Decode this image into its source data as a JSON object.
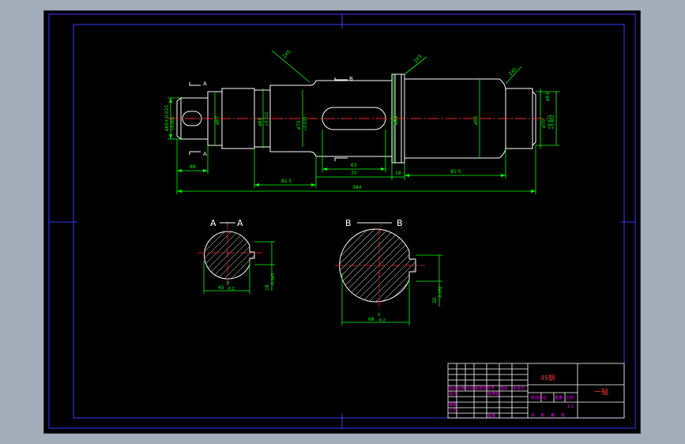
{
  "colors": {
    "background": "#a3adb9",
    "canvas": "#000000",
    "frame": "#3a3aff",
    "geometry": "#ffffff",
    "dimension": "#00ff00",
    "centerline": "#ff2020",
    "title_text": "#ff00ff",
    "title_grid": "#ffffff",
    "material_text": "#ff3030"
  },
  "main_view": {
    "section_a_label": "A",
    "section_b_label": "B",
    "dims": {
      "d_end": "ø60+0.021",
      "d_end_lower": "+0.002",
      "d_67": "ø67",
      "d_80": "ø80",
      "d_80_tol": "+0.021",
      "d_75": "ø75",
      "d_75_tol": "+0.030",
      "d_75_tol2": "+0.002",
      "d_84": "ø84",
      "d_90": "ø90",
      "d_70_right": "ø70",
      "d_70_tol": "+0.021",
      "d_70_tol2": "+0.002",
      "d_63": "ø63",
      "len_88": "88",
      "len_81_5": "81.5",
      "len_63": "63",
      "len_70": "70",
      "len_18": "18",
      "len_85_5": "85.5",
      "len_total": "384",
      "leader_c1": "2X5",
      "leader_c2": "2X3",
      "leader_c3": "2X5"
    }
  },
  "section_aa": {
    "title_left": "A",
    "title_right": "A",
    "dim_width": "45",
    "dim_width_tol_top": "0",
    "dim_width_tol_bottom": "-0.2",
    "dim_key": "18",
    "dim_key_tol": "-0.043"
  },
  "section_bb": {
    "title_left": "B",
    "title_right": "B",
    "dim_width": "68",
    "dim_width_tol_top": "0",
    "dim_width_tol_bottom": "-0.2",
    "dim_key": "20",
    "dim_key_tol": "-0.052"
  },
  "title_block": {
    "material": "45钢",
    "part_name": "一轴",
    "row_labels": [
      "标记",
      "处数",
      "分区",
      "更改文件号",
      "签名",
      "年月日"
    ],
    "design": "设计",
    "standard": "标准化",
    "stage": "阶段标记",
    "weight": "重量",
    "scale": "比例",
    "scale_value": "1:1",
    "review": "审核",
    "process": "工艺",
    "approve": "批准",
    "sheet_total": "共",
    "sheet": "张",
    "sheet_no": "第",
    "sheet2": "张"
  }
}
